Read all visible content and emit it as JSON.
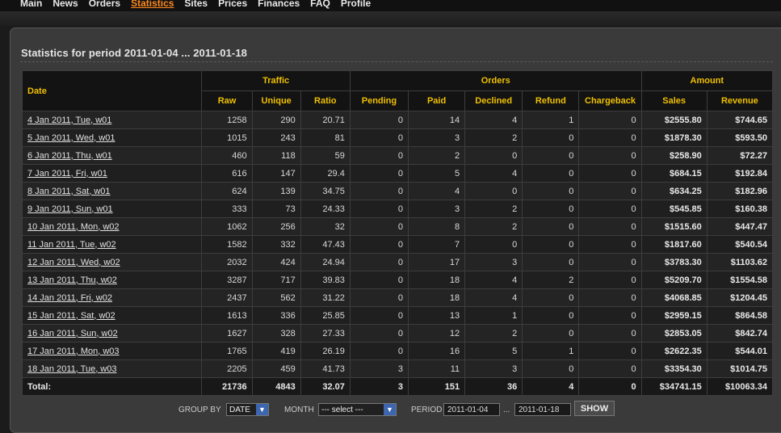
{
  "nav": {
    "items": [
      {
        "label": "Main"
      },
      {
        "label": "News"
      },
      {
        "label": "Orders"
      },
      {
        "label": "Statistics",
        "active": true
      },
      {
        "label": "Sites"
      },
      {
        "label": "Prices"
      },
      {
        "label": "Finances"
      },
      {
        "label": "FAQ"
      },
      {
        "label": "Profile"
      }
    ]
  },
  "panel": {
    "title": "Statistics for period 2011-01-04 ... 2011-01-18"
  },
  "table": {
    "groups": {
      "date": "Date",
      "traffic": "Traffic",
      "orders": "Orders",
      "amount": "Amount"
    },
    "columns": {
      "raw": "Raw",
      "unique": "Unique",
      "ratio": "Ratio",
      "pending": "Pending",
      "paid": "Paid",
      "declined": "Declined",
      "refund": "Refund",
      "chargeback": "Chargeback",
      "sales": "Sales",
      "revenue": "Revenue"
    },
    "rows": [
      [
        "4 Jan 2011, Tue, w01",
        "1258",
        "290",
        "20.71",
        "0",
        "14",
        "4",
        "1",
        "0",
        "$2555.80",
        "$744.65"
      ],
      [
        "5 Jan 2011, Wed, w01",
        "1015",
        "243",
        "81",
        "0",
        "3",
        "2",
        "0",
        "0",
        "$1878.30",
        "$593.50"
      ],
      [
        "6 Jan 2011, Thu, w01",
        "460",
        "118",
        "59",
        "0",
        "2",
        "0",
        "0",
        "0",
        "$258.90",
        "$72.27"
      ],
      [
        "7 Jan 2011, Fri, w01",
        "616",
        "147",
        "29.4",
        "0",
        "5",
        "4",
        "0",
        "0",
        "$684.15",
        "$192.84"
      ],
      [
        "8 Jan 2011, Sat, w01",
        "624",
        "139",
        "34.75",
        "0",
        "4",
        "0",
        "0",
        "0",
        "$634.25",
        "$182.96"
      ],
      [
        "9 Jan 2011, Sun, w01",
        "333",
        "73",
        "24.33",
        "0",
        "3",
        "2",
        "0",
        "0",
        "$545.85",
        "$160.38"
      ],
      [
        "10 Jan 2011, Mon, w02",
        "1062",
        "256",
        "32",
        "0",
        "8",
        "2",
        "0",
        "0",
        "$1515.60",
        "$447.47"
      ],
      [
        "11 Jan 2011, Tue, w02",
        "1582",
        "332",
        "47.43",
        "0",
        "7",
        "0",
        "0",
        "0",
        "$1817.60",
        "$540.54"
      ],
      [
        "12 Jan 2011, Wed, w02",
        "2032",
        "424",
        "24.94",
        "0",
        "17",
        "3",
        "0",
        "0",
        "$3783.30",
        "$1103.62"
      ],
      [
        "13 Jan 2011, Thu, w02",
        "3287",
        "717",
        "39.83",
        "0",
        "18",
        "4",
        "2",
        "0",
        "$5209.70",
        "$1554.58"
      ],
      [
        "14 Jan 2011, Fri, w02",
        "2437",
        "562",
        "31.22",
        "0",
        "18",
        "4",
        "0",
        "0",
        "$4068.85",
        "$1204.45"
      ],
      [
        "15 Jan 2011, Sat, w02",
        "1613",
        "336",
        "25.85",
        "0",
        "13",
        "1",
        "0",
        "0",
        "$2959.15",
        "$864.58"
      ],
      [
        "16 Jan 2011, Sun, w02",
        "1627",
        "328",
        "27.33",
        "0",
        "12",
        "2",
        "0",
        "0",
        "$2853.05",
        "$842.74"
      ],
      [
        "17 Jan 2011, Mon, w03",
        "1765",
        "419",
        "26.19",
        "0",
        "16",
        "5",
        "1",
        "0",
        "$2622.35",
        "$544.01"
      ],
      [
        "18 Jan 2011, Tue, w03",
        "2205",
        "459",
        "41.73",
        "3",
        "11",
        "3",
        "0",
        "0",
        "$3354.30",
        "$1014.75"
      ]
    ],
    "total": [
      "Total:",
      "21736",
      "4843",
      "32.07",
      "3",
      "151",
      "36",
      "4",
      "0",
      "$34741.15",
      "$10063.34"
    ]
  },
  "filters": {
    "group_by_label": "GROUP BY",
    "group_by_value": "DATE",
    "month_label": "MONTH",
    "month_value": "--- select ---",
    "period_label": "PERIOD",
    "period_from": "2011-01-04",
    "period_sep": "...",
    "period_to": "2011-01-18",
    "show_label": "SHOW"
  },
  "colors": {
    "accent_nav": "#ff8a1e",
    "header_text": "#f0c000",
    "select_arrow": "#3c66b0"
  }
}
